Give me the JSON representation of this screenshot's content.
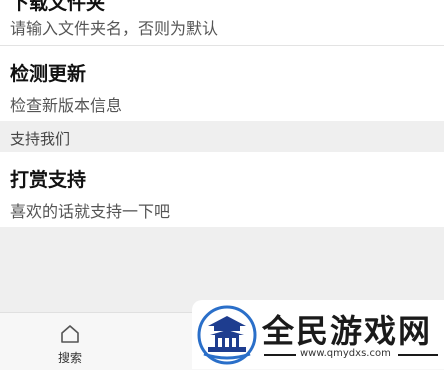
{
  "settings": {
    "folder": {
      "title": "下载文件夹",
      "desc": "请输入文件夹名，否则为默认"
    },
    "update": {
      "title": "检测更新",
      "desc": "检查新版本信息"
    },
    "support_section": "支持我们",
    "donate": {
      "title": "打赏支持",
      "desc": "喜欢的话就支持一下吧"
    }
  },
  "bottom_nav": {
    "search_label": "搜索",
    "search_icon": "home-icon"
  },
  "watermark": {
    "title": "全民游戏网",
    "url": "www.qmydxs.com"
  },
  "colors": {
    "accent": "#2a6fc9",
    "section_bg": "#efefef"
  }
}
